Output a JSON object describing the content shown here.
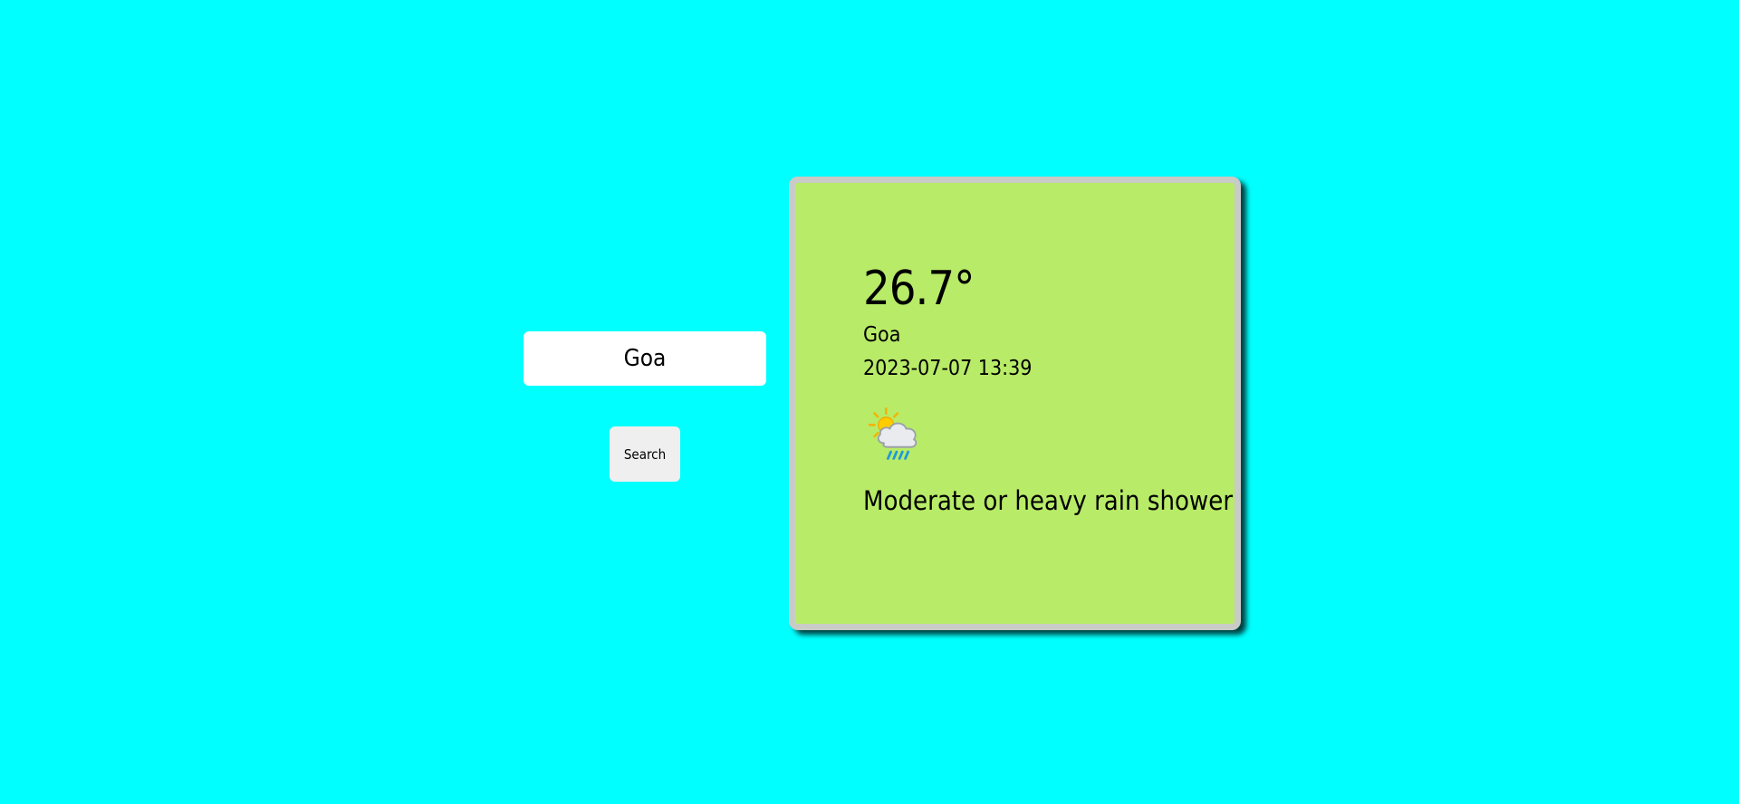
{
  "search": {
    "value": "Goa",
    "button_label": "Search"
  },
  "weather": {
    "temperature": "26.7°",
    "city": "Goa",
    "datetime": "2023-07-07 13:39",
    "condition": "Moderate or heavy rain shower",
    "condition_icon": "sun-cloud-rain-icon"
  },
  "colors": {
    "page_background": "#00ffff",
    "card_background": "#b8eb67",
    "card_border": "#c9cbc6"
  }
}
